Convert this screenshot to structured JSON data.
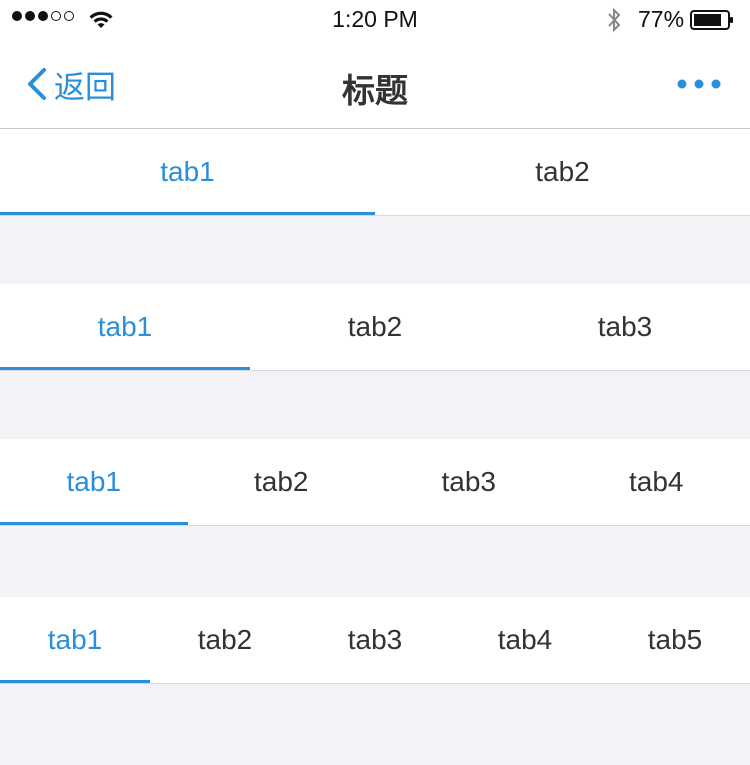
{
  "status_bar": {
    "time": "1:20 PM",
    "battery_percent": "77%",
    "signal_bars": 3,
    "signal_total": 5
  },
  "nav": {
    "back_label": "返回",
    "title": "标题",
    "more_icon": "more-dots-icon"
  },
  "tab_groups": [
    {
      "tabs": [
        "tab1",
        "tab2"
      ],
      "active_index": 0
    },
    {
      "tabs": [
        "tab1",
        "tab2",
        "tab3"
      ],
      "active_index": 0
    },
    {
      "tabs": [
        "tab1",
        "tab2",
        "tab3",
        "tab4"
      ],
      "active_index": 0
    },
    {
      "tabs": [
        "tab1",
        "tab2",
        "tab3",
        "tab4",
        "tab5"
      ],
      "active_index": 0
    }
  ],
  "colors": {
    "accent": "#2a8fdb",
    "background": "#f3f3f7",
    "text": "#333333"
  }
}
